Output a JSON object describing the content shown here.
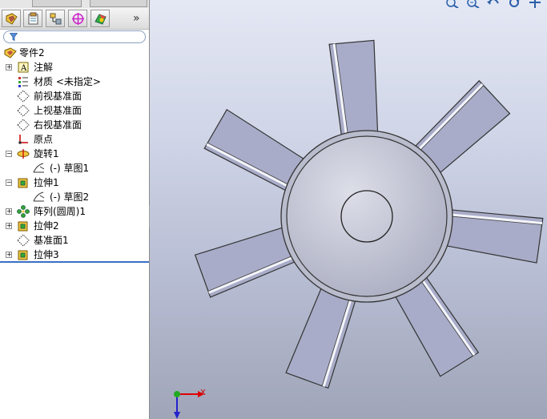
{
  "feature_tree": {
    "root": {
      "label": "零件2",
      "icon": "part-icon"
    },
    "items": [
      {
        "label": "注解",
        "icon": "annotation-icon",
        "expandable": true,
        "indent": 0
      },
      {
        "label": "材质 <未指定>",
        "icon": "material-icon",
        "expandable": false,
        "indent": 0
      },
      {
        "label": "前视基准面",
        "icon": "plane-icon",
        "expandable": false,
        "indent": 0
      },
      {
        "label": "上视基准面",
        "icon": "plane-icon",
        "expandable": false,
        "indent": 0
      },
      {
        "label": "右视基准面",
        "icon": "plane-icon",
        "expandable": false,
        "indent": 0
      },
      {
        "label": "原点",
        "icon": "origin-icon",
        "expandable": false,
        "indent": 0
      },
      {
        "label": "旋转1",
        "icon": "revolve-icon",
        "expandable": true,
        "expanded": true,
        "indent": 0
      },
      {
        "label": "(-) 草图1",
        "icon": "sketch-icon",
        "expandable": false,
        "indent": 1
      },
      {
        "label": "拉伸1",
        "icon": "extrude-icon",
        "expandable": true,
        "expanded": true,
        "indent": 0
      },
      {
        "label": "(-) 草图2",
        "icon": "sketch-icon",
        "expandable": false,
        "indent": 1
      },
      {
        "label": "阵列(圆周)1",
        "icon": "circular-pattern-icon",
        "expandable": true,
        "indent": 0
      },
      {
        "label": "拉伸2",
        "icon": "extrude-icon",
        "expandable": true,
        "indent": 0
      },
      {
        "label": "基准面1",
        "icon": "plane-icon",
        "expandable": false,
        "indent": 0
      },
      {
        "label": "拉伸3",
        "icon": "extrude-icon",
        "expandable": true,
        "indent": 0
      }
    ]
  },
  "manager_tabs": [
    {
      "icon": "feature-manager-icon"
    },
    {
      "icon": "property-manager-icon"
    },
    {
      "icon": "configuration-manager-icon"
    },
    {
      "icon": "dimxpert-manager-icon"
    },
    {
      "icon": "display-manager-icon"
    }
  ],
  "expand_arrows": "»",
  "view_toolbar": [
    "zoom-to-fit-icon",
    "zoom-area-icon",
    "previous-view-icon",
    "rotate-icon",
    "pan-icon"
  ],
  "triad": {
    "x_label": "X"
  },
  "colors": {
    "blade": "#a8acc8",
    "hub": "#c8cad8",
    "accent": "#3b6fc3"
  }
}
